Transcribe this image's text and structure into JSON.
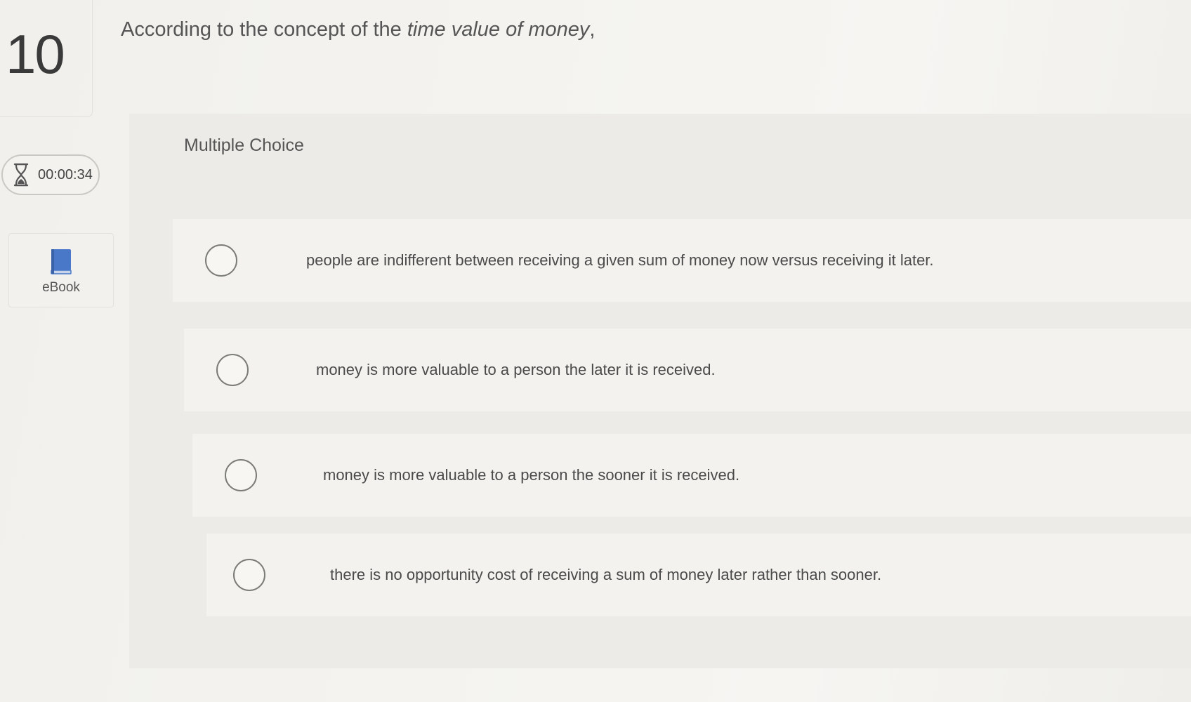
{
  "question": {
    "number": "10",
    "prompt_prefix": "According to the concept of the ",
    "prompt_emphasis": "time value of money",
    "prompt_suffix": ","
  },
  "timer": {
    "icon": "hourglass-icon",
    "value": "00:00:34"
  },
  "ebook": {
    "icon": "book-icon",
    "label": "eBook"
  },
  "multiple_choice": {
    "label": "Multiple Choice",
    "choices": [
      {
        "text": "people are indifferent between receiving a given sum of money now versus receiving it later."
      },
      {
        "text": "money is more valuable to a person the later it is received."
      },
      {
        "text": "money is more valuable to a person the sooner it is received."
      },
      {
        "text": "there is no opportunity cost of receiving a sum of money later rather than sooner."
      }
    ]
  },
  "colors": {
    "accent_book": "#4a78c8",
    "radio_border": "#7b7b78"
  }
}
